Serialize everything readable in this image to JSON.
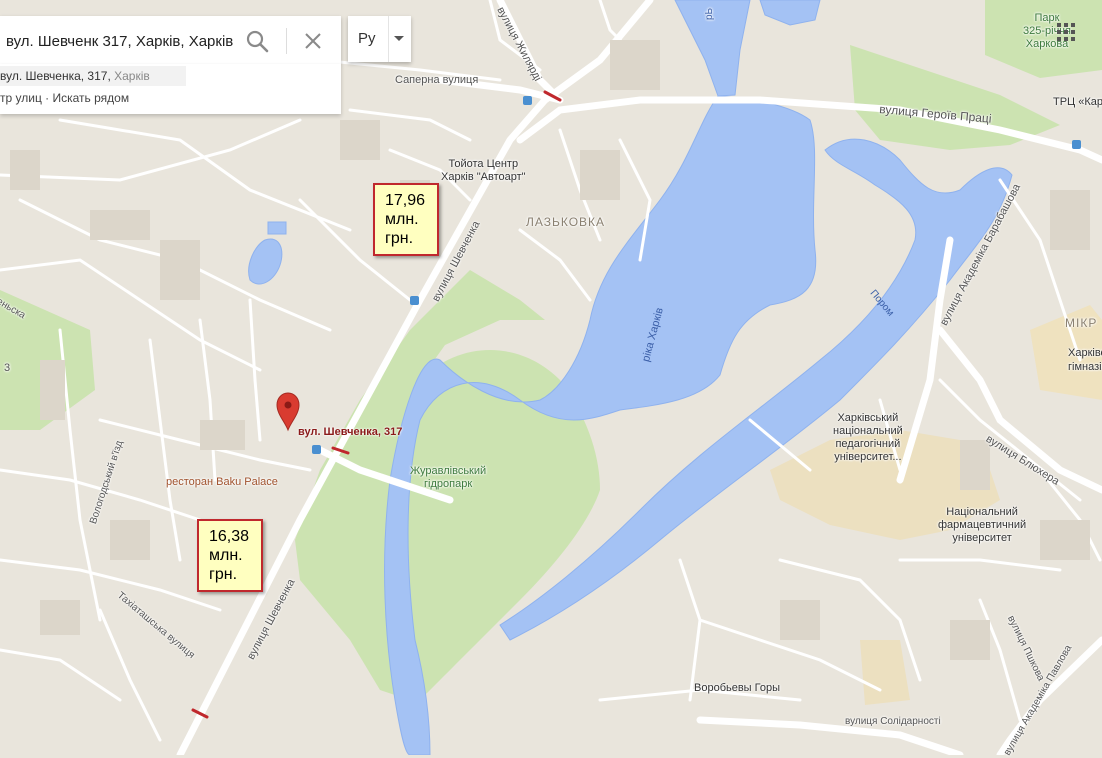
{
  "search": {
    "query": "вул. Шевченк 317, Харків, Харків",
    "placeholder": ""
  },
  "suggestion": {
    "street": "вул. Шевченка, 317, ",
    "city": "Харків",
    "actions": "тр улиц · Искать рядом"
  },
  "language": {
    "label": "Ру"
  },
  "icons": {
    "search": "search-icon",
    "close": "close-icon",
    "dropdown": "chevron-down-icon",
    "apps": "apps-grid-icon",
    "pin": "map-pin-icon"
  },
  "marker": {
    "label": "вул. Шевченка, 317"
  },
  "prices": [
    {
      "line1": "17,96",
      "line2": "млн.",
      "line3": "грн."
    },
    {
      "line1": "16,38",
      "line2": "млн.",
      "line3": "грн."
    }
  ],
  "labels": {
    "street_zhyliardi": "вулиця Жилярді",
    "street_saperna": "Саперна вулиця",
    "street_heroiv_pratsi": "вулиця Героїв Праці",
    "park_325_line1": "Парк",
    "park_325_line2": "325-річчя",
    "park_325_line3": "Харкова",
    "trts": "ТРЦ «Кар",
    "toyota_line1": "Тойота Центр",
    "toyota_line2": "Харків \"Автоарт\"",
    "district_laskovka": "ЛАЗЬКОВКА",
    "street_shevchenka_top": "вулиця Шевченка",
    "river_kharkiv": "ріка Харків",
    "porom": "Пором",
    "street_barabashova": "вулиця Академіка Барабашова",
    "mikr": "МІКР",
    "gymnasium_line1": "Харківська",
    "gymnasium_line2": "гімназія № 5",
    "ped_univ_line1": "Харківський",
    "ped_univ_line2": "національний",
    "ped_univ_line3": "педагогічний",
    "ped_univ_line4": "університет...",
    "street_bliukhera": "вулиця Блюхера",
    "pharm_univ_line1": "Національний",
    "pharm_univ_line2": "фармацевтичний",
    "pharm_univ_line3": "університет",
    "zhuravlivsky_line1": "Журавлівський",
    "zhuravlivsky_line2": "гідропарк",
    "restaurant": "ресторан Baku Palace",
    "vologodsky": "Вологодський в'їзд",
    "street_shevchenka_bottom": "вулиця Шевченка",
    "takhiatashska": "Тахіаташська вулиця",
    "street_pshkova": "вулиця Пшкова",
    "vorobiovy_gory": "Воробьевы Горы",
    "street_solidarnosti": "вулиця Солідарності",
    "street_pavlova": "вулиця Академіка Павлова",
    "left_edge": "еньска",
    "left_edge_num": "3",
    "brand_top": "рЬ"
  },
  "colors": {
    "land": "#e9e5dc",
    "road": "#ffffff",
    "water": "#a4c2f4",
    "water_stroke": "#7ea6ea",
    "park": "#cce3b1",
    "campus": "#ece0c0",
    "price_bg": "#ffffc0",
    "price_border": "#c0282d",
    "pin": "#d93b30"
  }
}
